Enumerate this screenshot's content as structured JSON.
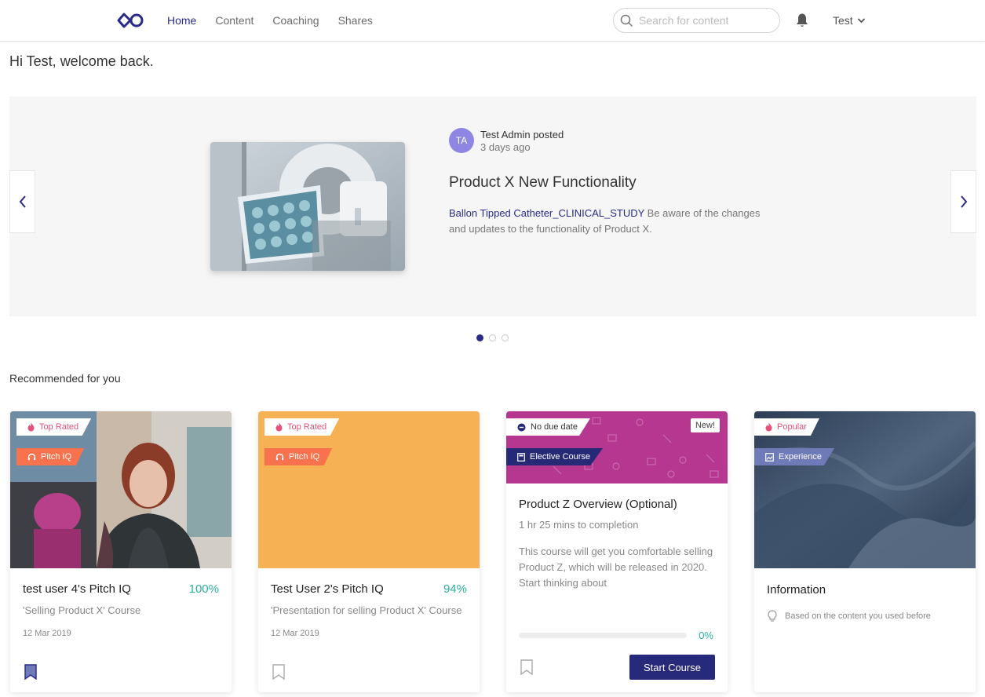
{
  "nav": {
    "items": [
      {
        "label": "Home",
        "active": true
      },
      {
        "label": "Content",
        "active": false
      },
      {
        "label": "Coaching",
        "active": false
      },
      {
        "label": "Shares",
        "active": false
      }
    ],
    "search_placeholder": "Search for content",
    "user_name": "Test",
    "icons": [
      "logo-icon",
      "search-icon",
      "bell-icon",
      "chevron-down-icon"
    ]
  },
  "welcome": "Hi Test, welcome back.",
  "carousel": {
    "avatar_initials": "TA",
    "poster": "Test Admin posted",
    "posted_time": "3 days ago",
    "title": "Product X New Functionality",
    "desc_link": "Ballon Tipped Catheter_CLINICAL_STUDY",
    "desc_text": " Be aware of the changes and updates to the functionality of Product X.",
    "active_index": 0,
    "slide_count": 3
  },
  "recommended": {
    "title": "Recommended for you",
    "cards": [
      {
        "tag1": "Top Rated",
        "tag2": "Pitch IQ",
        "title": "test user 4's Pitch IQ",
        "percent": "100%",
        "subtitle": "'Selling Product X' Course",
        "date": "12 Mar 2019",
        "bookmarked": true
      },
      {
        "tag1": "Top Rated",
        "tag2": "Pitch IQ",
        "title": "Test User 2's Pitch IQ",
        "percent": "94%",
        "subtitle": "'Presentation for selling Product X' Course",
        "date": "12 Mar 2019",
        "bookmarked": false
      },
      {
        "tag1": "No due date",
        "tag2": "Elective Course",
        "badge": "New!",
        "title": "Product Z Overview (Optional)",
        "duration": "1 hr 25 mins to completion",
        "description": "This course will get you comfortable selling Product Z, which will be released in 2020. Start thinking about",
        "progress": 0,
        "percent": "0%",
        "button": "Start Course",
        "bookmarked": false
      },
      {
        "tag1": "Popular",
        "tag2": "Experience",
        "title": "Information",
        "hint": "Based on the content you used before"
      }
    ]
  },
  "colors": {
    "brand_navy": "#27297a",
    "accent_teal": "#27b29b",
    "tag_orange": "#f7724d",
    "tag_pink": "#e2527b",
    "card2_bg": "#f7b155",
    "card3_bg": "#b5378f"
  }
}
